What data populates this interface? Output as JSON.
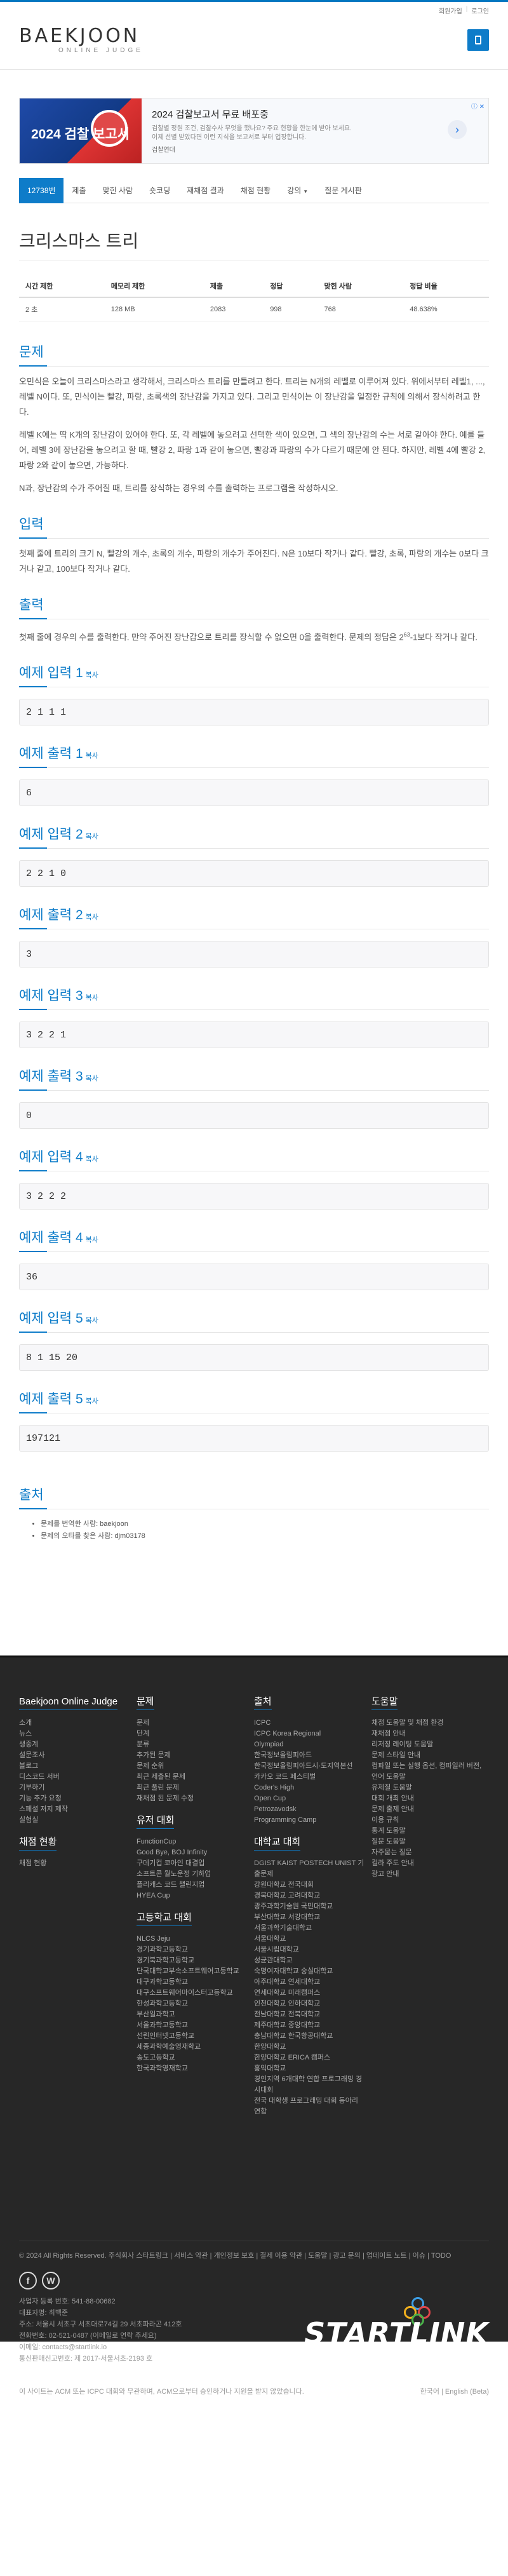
{
  "topbar": {
    "signup": "회원가입",
    "login": "로그인"
  },
  "logo": {
    "main": "BAEKJOON",
    "sub": "ONLINE JUDGE"
  },
  "ad": {
    "img_text": "2024 검찰 보고서",
    "title": "2024 검찰보고서 무료 배포중",
    "desc": "검찰별 정원 조건, 검찰수사 무엇을 했나요? 주요 현황을 한눈에 받아 보세요. 이제 선별 받았다면 이런 지식을 보고서로 부터 업장합니다.",
    "from": "검찰연대",
    "arrow": "›",
    "badge": "ⓘ ✕"
  },
  "tabs": [
    "12738번",
    "제출",
    "맞힌 사람",
    "숏코딩",
    "재채점 결과",
    "채점 현황",
    "강의",
    "질문 게시판"
  ],
  "title": "크리스마스 트리",
  "info": {
    "headers": [
      "시간 제한",
      "메모리 제한",
      "제출",
      "정답",
      "맞힌 사람",
      "정답 비율"
    ],
    "values": [
      "2 초",
      "128 MB",
      "2083",
      "998",
      "768",
      "48.638%"
    ]
  },
  "sections": {
    "problem": "문제",
    "input": "입력",
    "output": "출력",
    "source": "출처",
    "copy": "복사"
  },
  "problem_text": [
    "오민식은 오늘이 크리스마스라고 생각해서, 크리스마스 트리를 만들려고 한다. 트리는 N개의 레벨로 이루어져 있다. 위에서부터 레벨1, ..., 레벨 N이다. 또, 민식이는 빨강, 파랑, 초록색의 장난감을 가지고 있다. 그리고 민식이는 이 장난감을 일정한 규칙에 의해서 장식하려고 한다.",
    "레벨 K에는 딱 K개의 장난감이 있어야 한다. 또, 각 레벨에 놓으려고 선택한 색이 있으면, 그 색의 장난감의 수는 서로 같아야 한다. 예를 들어, 레벨 3에 장난감을 놓으려고 할 때, 빨강 2, 파랑 1과 같이 놓으면, 빨강과 파랑의 수가 다르기 때문에 안 된다. 하지만, 레벨 4에 빨강 2, 파랑 2와 같이 놓으면, 가능하다.",
    "N과, 장난감의 수가 주어질 때, 트리를 장식하는 경우의 수를 출력하는 프로그램을 작성하시오."
  ],
  "input_text": "첫째 줄에 트리의 크기 N, 빨강의 개수, 초록의 개수, 파랑의 개수가 주어진다. N은 10보다 작거나 같다. 빨강, 초록, 파랑의 개수는 0보다 크거나 같고, 100보다 작거나 같다.",
  "output_text_a": "첫째 줄에 경우의 수를 출력한다. 만약 주어진 장난감으로 트리를 장식할 수 없으면 0을 출력한다. 문제의 정답은 2",
  "output_sup": "63",
  "output_text_b": "-1보다 작거나 같다.",
  "examples": [
    {
      "in_label": "예제 입력 1",
      "in": "2 1 1 1",
      "out_label": "예제 출력 1",
      "out": "6"
    },
    {
      "in_label": "예제 입력 2",
      "in": "2 2 1 0",
      "out_label": "예제 출력 2",
      "out": "3"
    },
    {
      "in_label": "예제 입력 3",
      "in": "3 2 2 1",
      "out_label": "예제 출력 3",
      "out": "0"
    },
    {
      "in_label": "예제 입력 4",
      "in": "3 2 2 2",
      "out_label": "예제 출력 4",
      "out": "36"
    },
    {
      "in_label": "예제 입력 5",
      "in": "8 1 15 20",
      "out_label": "예제 출력 5",
      "out": "197121"
    }
  ],
  "source_items": [
    "문제를 번역한 사람: baekjoon",
    "문제의 오타를 찾은 사람: djm03178"
  ],
  "footer": {
    "cols": [
      {
        "title": "Baekjoon Online Judge",
        "links": [
          "소개",
          "뉴스",
          "생중계",
          "설문조사",
          "블로그",
          "디스코드 서버",
          "기부하기",
          "기능 추가 요청",
          "스페셜 저지 제작",
          "실험실"
        ],
        "sub_title": "채점 현황",
        "sub_links": [
          "채점 현황"
        ]
      },
      {
        "title": "문제",
        "links": [
          "문제",
          "단계",
          "분류",
          "추가된 문제",
          "문제 순위",
          "최근 제출된 문제",
          "최근 풀린 문제",
          "재채점 된 문제 수정"
        ],
        "sub_title": "유저 대회",
        "sub_links": [
          "FunctionCup",
          "Good Bye, BOJ Infinity",
          "구데기컵 코아인 대결업",
          "소프트콘 월노운정 기하업",
          "플리캐스 코드 챌린지업",
          "HYEA Cup"
        ],
        "sub2_title": "고등학교 대회",
        "sub2_links": [
          "NLCS Jeju",
          "경기과학고등학교",
          "경기북과학고등학교",
          "단국대학교부속소프트웨어고등학교",
          "대구과학고등학교",
          "대구소프트웨어마이스터고등학교",
          "한성과학고등학교",
          "부산일과학고",
          "서울과학고등학교",
          "선린인터넷고등학교",
          "세종과학예술영재학교",
          "송도고등학교",
          "한국과학영재학교"
        ]
      },
      {
        "title": "출처",
        "links": [
          "ICPC",
          "ICPC Korea Regional",
          "Olympiad",
          "한국정보올림피아드",
          "한국정보올림피아드시·도지역본선",
          "카카오 코드 페스티벌",
          "Coder's High",
          "Open Cup",
          "Petrozavodsk",
          "Programming Camp"
        ],
        "sub_title": "대학교 대회",
        "sub_links": [
          "DGIST KAIST POSTECH UNIST 기출문제",
          "강원대학교 전국대회",
          "경북대학교 고려대학교",
          "광주과학기술원 국민대학교",
          "부산대학교 서강대학교",
          "서울과학기술대학교",
          "서울대학교",
          "서울시립대학교",
          "성균관대학교",
          "숙명여자대학교 숭실대학교",
          "아주대학교 연세대학교",
          "연세대학교 미래캠퍼스",
          "인천대학교 인하대학교",
          "전남대학교 전북대학교",
          "제주대학교 중앙대학교",
          "충남대학교 한국항공대학교",
          "한양대학교",
          "한양대학교 ERICA 캠퍼스",
          "홍익대학교",
          "경인지역 6개대학 연합 프로그래밍 경시대회",
          "전국 대학생 프로그래밍 대회 동아리 연합"
        ]
      },
      {
        "title": "도움말",
        "links": [
          "채점 도움말 및 채점 환경",
          "재채점 안내",
          "리저징 레이팅 도움말",
          "문제 스타일 안내",
          "컴파일 또는 실행 옵션, 컴파일러 버전, 언어 도움말",
          "유제질 도움말",
          "대회 개최 안내",
          "문제 출제 안내",
          "이용 규칙",
          "통계 도움말",
          "질문 도움말",
          "자주묻는 질문",
          "컬라 주도 안내",
          "광고 안내"
        ]
      }
    ],
    "copyright": "© 2024 All Rights Reserved. 주식회사 스타트링크  |  서비스 약관  |  개인정보 보호  |  결제 이용 약관  |  도움말  |  광고 문의  |  업데이트 노트  |  이슈  |  TODO",
    "corp_lines": [
      "사업자 등록 번호: 541-88-00682",
      "대표자명: 최백준",
      "주소: 서울시 서초구 서초대로74길 29 서초파라곤 412호",
      "전화번호: 02-521-0487 (이메일로 연락 주세요)",
      "이메일: contacts@startlink.io",
      "통신판매신고번호: 제 2017-서울서초-2193 호"
    ],
    "brand": "STARTLINK",
    "notice": "이 사이트는 ACM 또는 ICPC 대회와 무관하며, ACM으로부터 승인하거나 지원을 받지 않았습니다.",
    "lang": "한국어  |  English (Beta)"
  }
}
